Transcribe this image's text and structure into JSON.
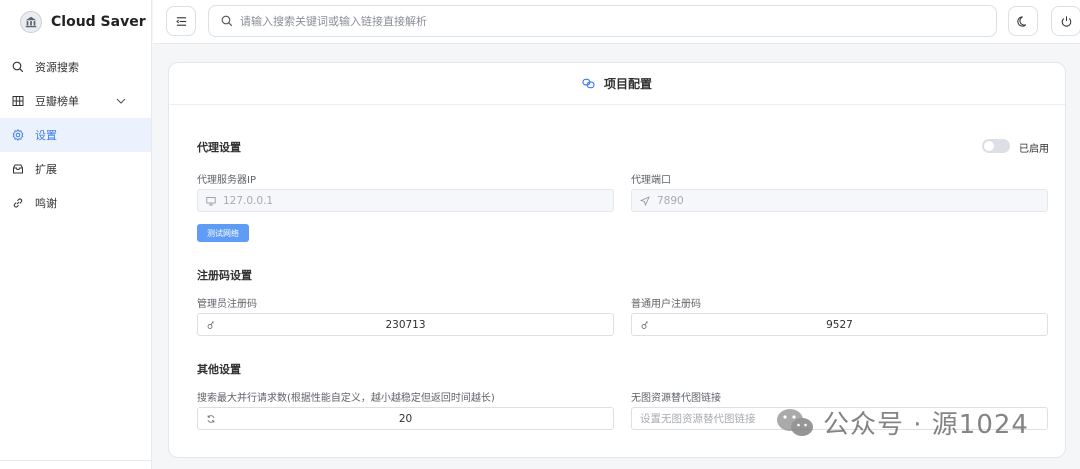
{
  "app": {
    "name": "Cloud Saver"
  },
  "sidebar": {
    "items": [
      {
        "label": "资源搜索",
        "icon": "search-icon"
      },
      {
        "label": "豆瓣榜单",
        "icon": "grid-icon"
      },
      {
        "label": "设置",
        "icon": "gear-icon",
        "active": true
      },
      {
        "label": "扩展",
        "icon": "box-icon"
      },
      {
        "label": "鸣谢",
        "icon": "link-icon"
      }
    ]
  },
  "header": {
    "search_placeholder": "请输入搜索关键词或输入链接直接解析"
  },
  "card": {
    "title": "项目配置"
  },
  "proxy": {
    "title": "代理设置",
    "toggle_label": "已启用",
    "enabled": false,
    "host_label": "代理服务器IP",
    "host_placeholder": "127.0.0.1",
    "port_label": "代理端口",
    "port_placeholder": "7890",
    "test_button": "测试网络"
  },
  "registration": {
    "title": "注册码设置",
    "admin_label": "管理员注册码",
    "admin_value": "230713",
    "user_label": "普通用户注册码",
    "user_value": "9527"
  },
  "other": {
    "title": "其他设置",
    "concurrency_label": "搜索最大并行请求数(根据性能自定义，越小越稳定但返回时间越长)",
    "concurrency_value": "20",
    "fallback_image_label": "无图资源替代图链接",
    "fallback_image_placeholder": "设置无图资源替代图链接"
  },
  "watermark": {
    "text": "公众号 · 源1024"
  },
  "colors": {
    "accent": "#3a7bea",
    "button": "#5e9cf5",
    "active_bg": "#ecf2fd"
  }
}
